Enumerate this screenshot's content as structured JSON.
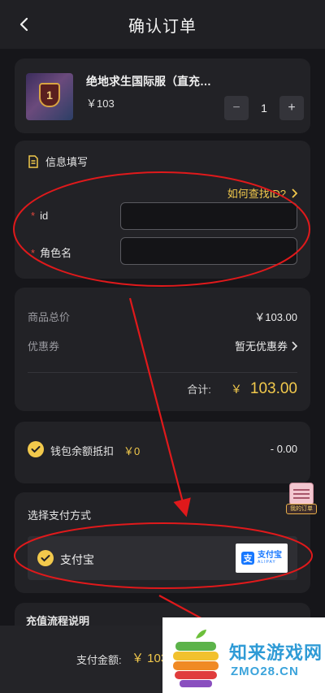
{
  "header": {
    "title": "确认订单"
  },
  "product": {
    "name": "绝地求生国际服（直充…",
    "price": "￥103",
    "quantity": "1",
    "minus": "−",
    "plus": "+"
  },
  "info": {
    "title": "信息填写",
    "find_id_link": "如何查找ID?",
    "fields": [
      {
        "required_mark": "*",
        "label": "id",
        "value": ""
      },
      {
        "required_mark": "*",
        "label": "角色名",
        "value": ""
      }
    ]
  },
  "totals": {
    "goods_total_label": "商品总价",
    "goods_total_value": "￥103.00",
    "coupon_label": "优惠券",
    "coupon_value": "暂无优惠券",
    "sum_label": "合计:",
    "sum_currency": "￥",
    "sum_value": "103.00"
  },
  "wallet": {
    "label": "钱包余额抵扣",
    "balance": "￥0",
    "deduction": "- 0.00"
  },
  "payment": {
    "title": "选择支付方式",
    "option_label": "支付宝",
    "logo_cn": "支付宝",
    "logo_en": "ALIPAY",
    "logo_glyph": "支"
  },
  "flow": {
    "title": "充值流程说明"
  },
  "bottom": {
    "pay_label": "支付金额:",
    "pay_value": "￥ 103"
  },
  "float_badge": {
    "label": "我的订单"
  },
  "watermark": {
    "line1": "知来游戏网",
    "line2": "ZMO28.CN"
  },
  "colors": {
    "accent": "#f2c94c",
    "required": "#e0463c",
    "annotation": "#e0191b",
    "alipay": "#1677ff"
  }
}
